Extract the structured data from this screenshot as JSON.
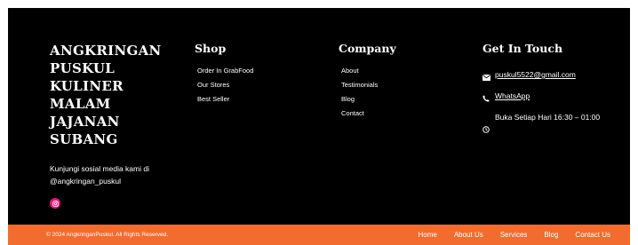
{
  "brand": {
    "title": "ANGKRINGAN PUSKUL KULINER MALAM JAJANAN SUBANG",
    "description": "Kunjungi sosial media kami di @angkringan_puskul",
    "social_icon": "instagram-icon",
    "social_color": "#e8127c"
  },
  "shop": {
    "heading": "Shop",
    "links": [
      "Order In GrabFood",
      "Our Stores",
      "Best Seller"
    ]
  },
  "company": {
    "heading": "Company",
    "links": [
      "About",
      "Testimonials",
      "Blog",
      "Contact"
    ]
  },
  "contact": {
    "heading": "Get In Touch",
    "email": "puskul5522@gmail.com",
    "whatsapp": "WhatsApp",
    "hours": "Buka Setiap Hari 16:30 – 01:00"
  },
  "bottom": {
    "copyright": "© 2024 AngkringanPuskul. All Rights Reserved.",
    "nav": [
      "Home",
      "About Us",
      "Services",
      "Blog",
      "Contact Us"
    ],
    "bar_color": "#f26b2f"
  }
}
